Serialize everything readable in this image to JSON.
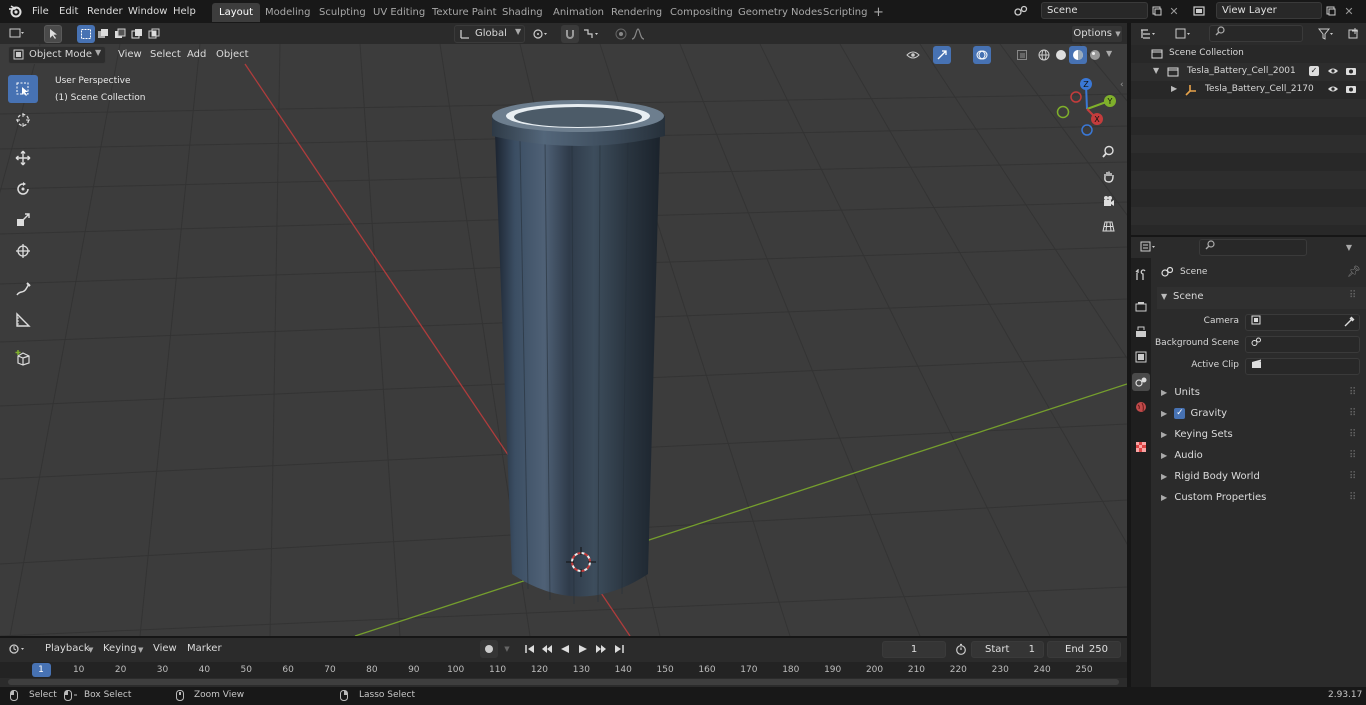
{
  "topbar": {
    "menus": [
      "File",
      "Edit",
      "Render",
      "Window",
      "Help"
    ],
    "workspaces": [
      "Layout",
      "Modeling",
      "Sculpting",
      "UV Editing",
      "Texture Paint",
      "Shading",
      "Animation",
      "Rendering",
      "Compositing",
      "Geometry Nodes",
      "Scripting"
    ],
    "active_workspace": "Layout",
    "add_tab": "+",
    "scene_field": "Scene",
    "view_layer_field": "View Layer"
  },
  "viewport_header": {
    "transform_orientation": "Global",
    "options_label": "Options",
    "mode": "Object Mode",
    "menus": [
      "View",
      "Select",
      "Add",
      "Object"
    ]
  },
  "viewport": {
    "perspective_label": "User Perspective",
    "collection_label": "(1) Scene Collection",
    "gizmo_axes": {
      "x": "X",
      "y": "Y",
      "z": "Z"
    }
  },
  "outliner": {
    "root": "Scene Collection",
    "items": [
      {
        "label": "Tesla_Battery_Cell_2001",
        "level": 1
      },
      {
        "label": "Tesla_Battery_Cell_2170",
        "level": 2
      }
    ]
  },
  "properties": {
    "context_label": "Scene",
    "panel_title": "Scene",
    "fields": [
      {
        "label": "Camera"
      },
      {
        "label": "Background Scene"
      },
      {
        "label": "Active Clip"
      }
    ],
    "subpanels": [
      "Units",
      "Gravity",
      "Keying Sets",
      "Audio",
      "Rigid Body World",
      "Custom Properties"
    ],
    "gravity_checked": true
  },
  "timeline": {
    "menus": [
      "Playback",
      "Keying",
      "View",
      "Marker"
    ],
    "current_frame": "1",
    "start_label": "Start",
    "start_value": "1",
    "end_label": "End",
    "end_value": "250",
    "ruler": [
      "1",
      "10",
      "20",
      "30",
      "40",
      "50",
      "60",
      "70",
      "80",
      "90",
      "100",
      "110",
      "120",
      "130",
      "140",
      "150",
      "160",
      "170",
      "180",
      "190",
      "200",
      "210",
      "220",
      "230",
      "240",
      "250"
    ]
  },
  "statusbar": {
    "hints": [
      "Select",
      "Box Select",
      "Zoom View",
      "Lasso Select"
    ],
    "version": "2.93.17"
  },
  "colors": {
    "accent": "#4772b3",
    "x_axis": "#c43c3c",
    "y_axis": "#7fb02b",
    "z_axis": "#3a78d6",
    "viewport_bg": "#3c3c3c"
  }
}
